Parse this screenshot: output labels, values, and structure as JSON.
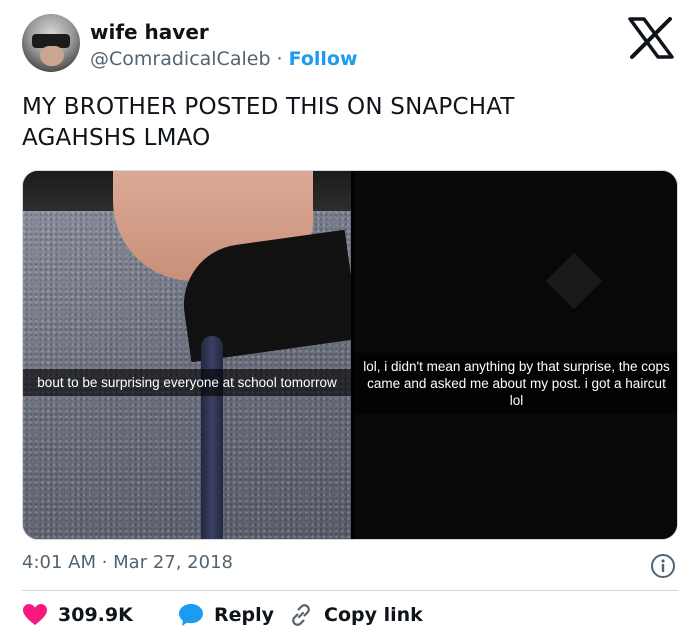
{
  "author": {
    "name": "wife haver",
    "handle": "@ComradicalCaleb",
    "separator": " · ",
    "follow_label": "Follow"
  },
  "tweet": {
    "text_line1": "MY BROTHER POSTED THIS ON SNAPCHAT",
    "text_line2": "AGAHSHS LMAO"
  },
  "media": {
    "left_caption": "bout to be surprising everyone at school tomorrow",
    "right_caption": "lol, i didn't mean anything by that surprise, the cops came and asked me about my post. i got a haircut lol"
  },
  "meta": {
    "timestamp": "4:01 AM · Mar 27, 2018"
  },
  "actions": {
    "like_count": "309.9K",
    "reply_label": "Reply",
    "copy_label": "Copy link"
  },
  "colors": {
    "accent": "#1d9bf0",
    "like": "#f91880",
    "secondary_text": "#536471"
  },
  "icons": {
    "brand": "x-logo-icon",
    "info": "info-icon",
    "like": "heart-icon",
    "reply": "speech-bubble-icon",
    "copy": "link-icon"
  }
}
